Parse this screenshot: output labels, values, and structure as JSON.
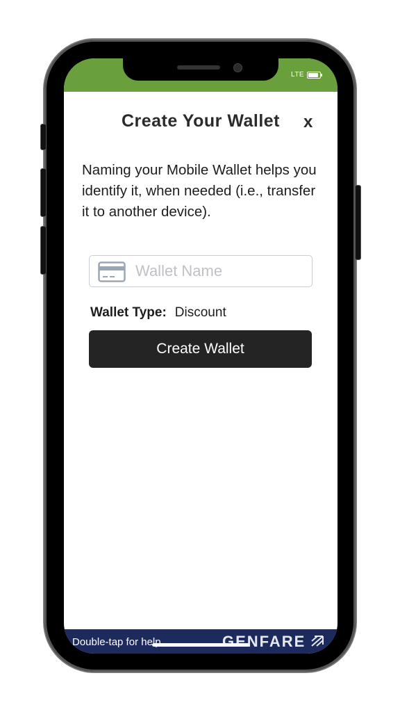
{
  "status_bar": {
    "network": "LTE",
    "battery_icon": "battery-full-icon",
    "color": "#6aa03c"
  },
  "dialog": {
    "title": "Create Your Wallet",
    "close_label": "x",
    "description": "Naming your Mobile Wallet helps you identify it, when needed (i.e., transfer it to another device).",
    "wallet_name": {
      "value": "",
      "placeholder": "Wallet Name",
      "icon": "credit-card-icon"
    },
    "wallet_type": {
      "label": "Wallet Type:",
      "value": "Discount"
    },
    "create_button_label": "Create Wallet"
  },
  "footer": {
    "help_text": "Double-tap for help",
    "brand": "GENFARE",
    "brand_icon": "genfare-logo-icon",
    "color": "#1d2a5e"
  }
}
